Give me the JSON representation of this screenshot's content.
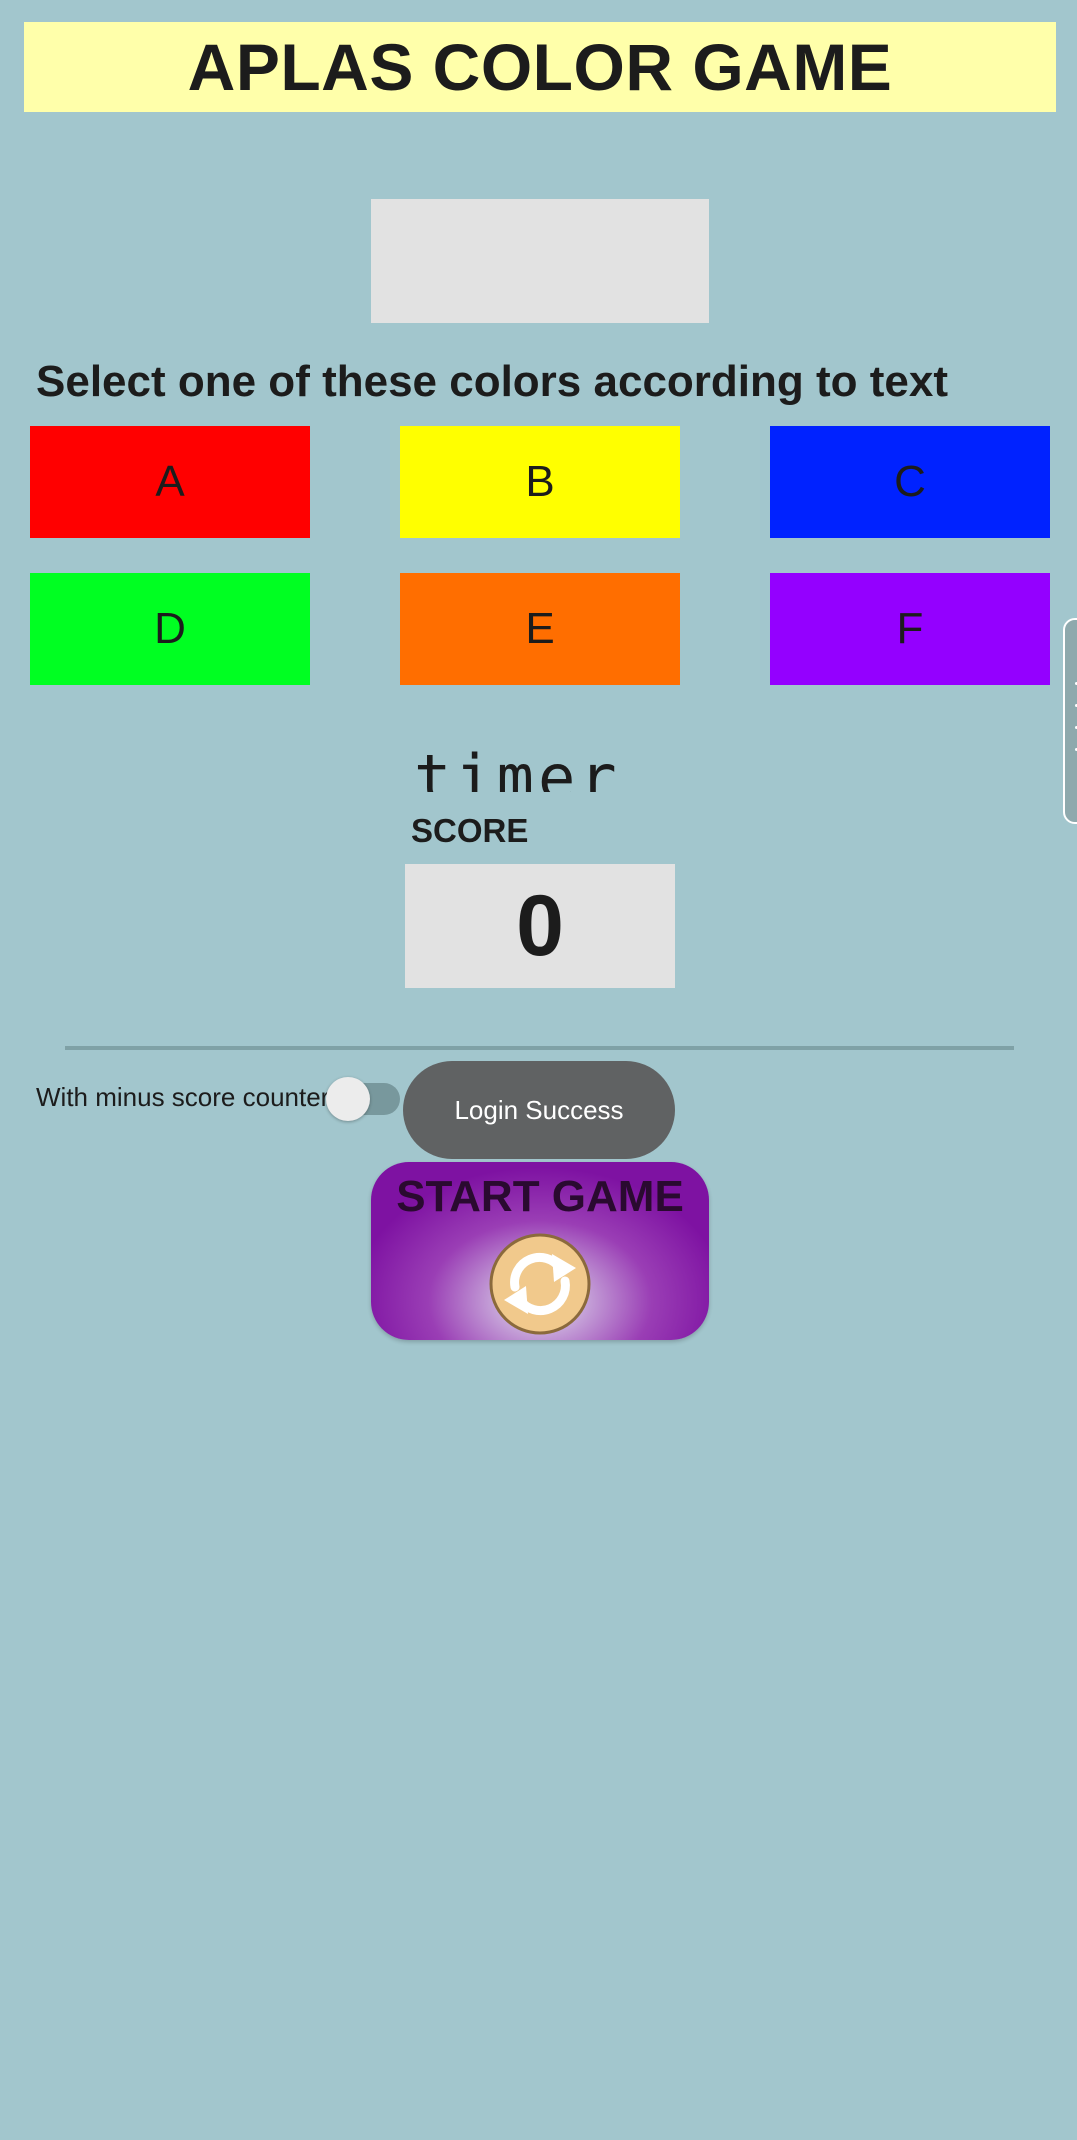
{
  "header": {
    "title": "APLAS COLOR GAME"
  },
  "instruction": "Select one of these colors according to text",
  "color_buttons": [
    {
      "label": "A",
      "color": "#ff0000"
    },
    {
      "label": "B",
      "color": "#ffff00"
    },
    {
      "label": "C",
      "color": "#0022ff"
    },
    {
      "label": "D",
      "color": "#00ff22"
    },
    {
      "label": "E",
      "color": "#ff6e00"
    },
    {
      "label": "F",
      "color": "#9400ff"
    }
  ],
  "timer": {
    "label": "timer"
  },
  "score": {
    "label": "SCORE",
    "value": "0"
  },
  "minus_counter": {
    "label": "With minus score counter",
    "enabled": false
  },
  "toast": {
    "text": "Login Success"
  },
  "start_button": {
    "label": "START GAME",
    "icon": "refresh-icon"
  },
  "colors": {
    "background": "#a2c6cd",
    "title_bar": "#ffffaa",
    "box": "#e2e2e2"
  }
}
